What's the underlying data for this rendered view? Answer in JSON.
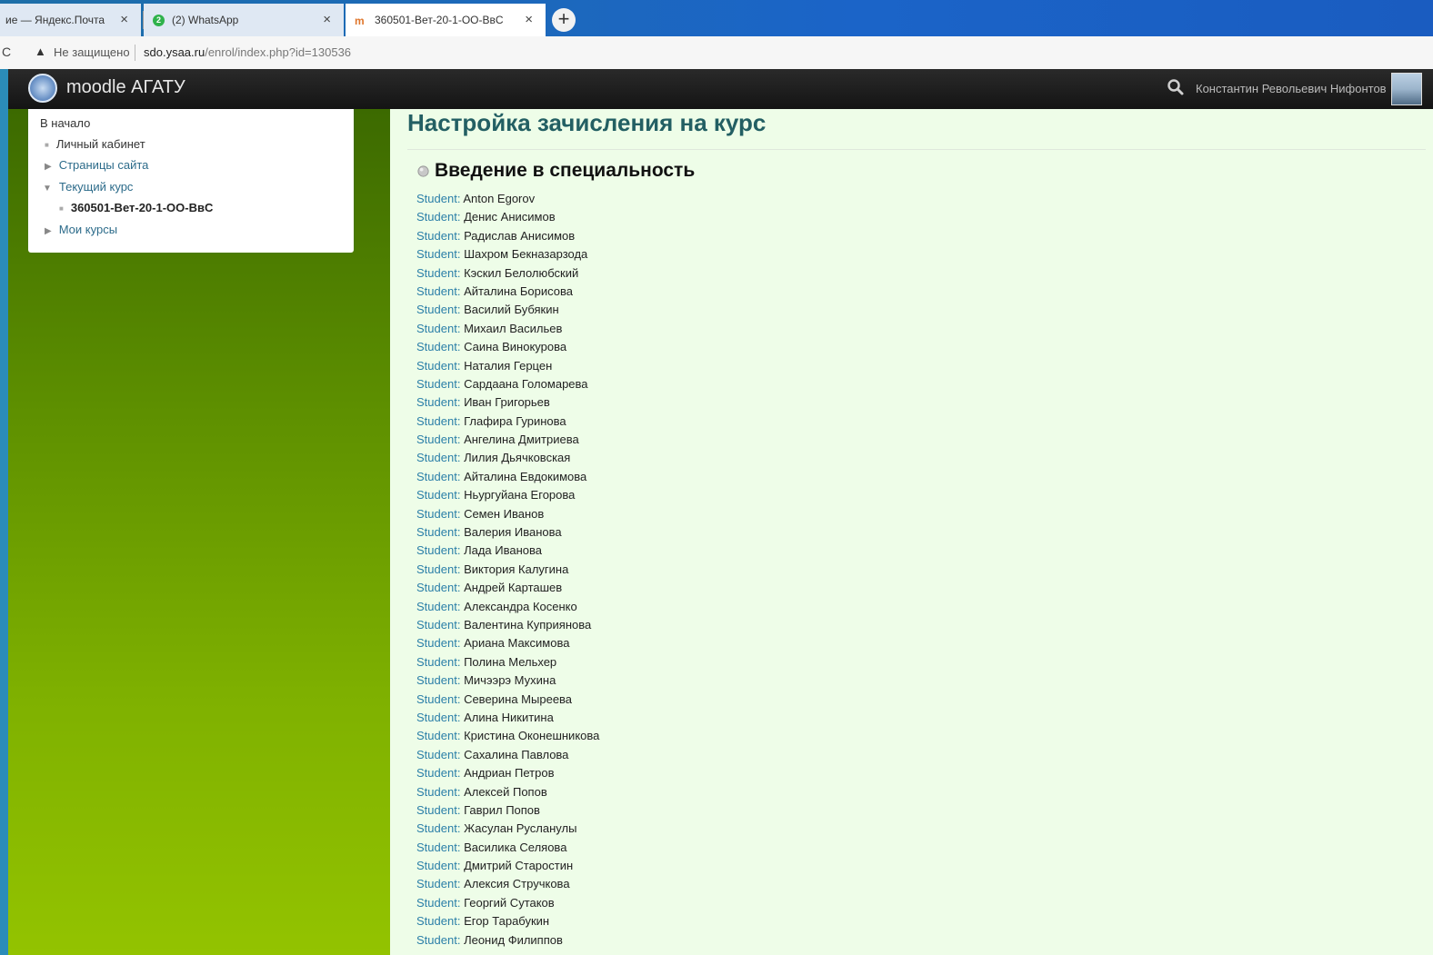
{
  "browser": {
    "tabs": [
      {
        "label": "ие — Яндекс.Почта",
        "close": "×"
      },
      {
        "label": "(2) WhatsApp",
        "close": "×"
      },
      {
        "label": "360501-Вет-20-1-ОО-ВвС",
        "close": "×"
      }
    ],
    "new_tab": "+",
    "address": {
      "security_label": "Не защищено",
      "host": "sdo.ysaa.ru",
      "path": "/enrol/index.php?id=130536"
    }
  },
  "navbar": {
    "brand": "moodle АГАТУ",
    "user_name": "Константин Револьевич Нифонтов"
  },
  "sidebar": {
    "home": "В начало",
    "items": [
      {
        "label": "Личный кабинет"
      },
      {
        "label": "Страницы сайта"
      },
      {
        "label": "Текущий курс"
      },
      {
        "label": "360501-Вет-20-1-ОО-ВвС"
      },
      {
        "label": "Мои курсы"
      }
    ]
  },
  "main": {
    "page_title": "Настройка зачисления на курс",
    "course_name": "Введение в специальность",
    "role_label": "Student:",
    "students": [
      "Anton Egorov",
      "Денис Анисимов",
      "Радислав Анисимов",
      "Шахром Бекназарзода",
      "Кэскил Белолюбский",
      "Айталина Борисова",
      "Василий Бубякин",
      "Михаил Васильев",
      "Саина Винокурова",
      "Наталия Герцен",
      "Сардаана Голомарева",
      "Иван Григорьев",
      "Глафира Гуринова",
      "Ангелина Дмитриева",
      "Лилия Дьячковская",
      "Айталина Евдокимова",
      "Ньургуйана Егорова",
      "Семен Иванов",
      "Валерия Иванова",
      "Лада Иванова",
      "Виктория Калугина",
      "Андрей Карташев",
      "Александра Косенко",
      "Валентина Куприянова",
      "Ариана Максимова",
      "Полина Мельхер",
      "Мичээрэ Мухина",
      "Северина Мыреева",
      "Алина Никитина",
      "Кристина Оконешникова",
      "Сахалина Павлова",
      "Андриан Петров",
      "Алексей Попов",
      "Гаврил Попов",
      "Жасулан Русланулы",
      "Василика Селяова",
      "Дмитрий Старостин",
      "Алексия Стручкова",
      "Георгий Сутаков",
      "Егор Тарабукин",
      "Леонид Филиппов"
    ]
  }
}
